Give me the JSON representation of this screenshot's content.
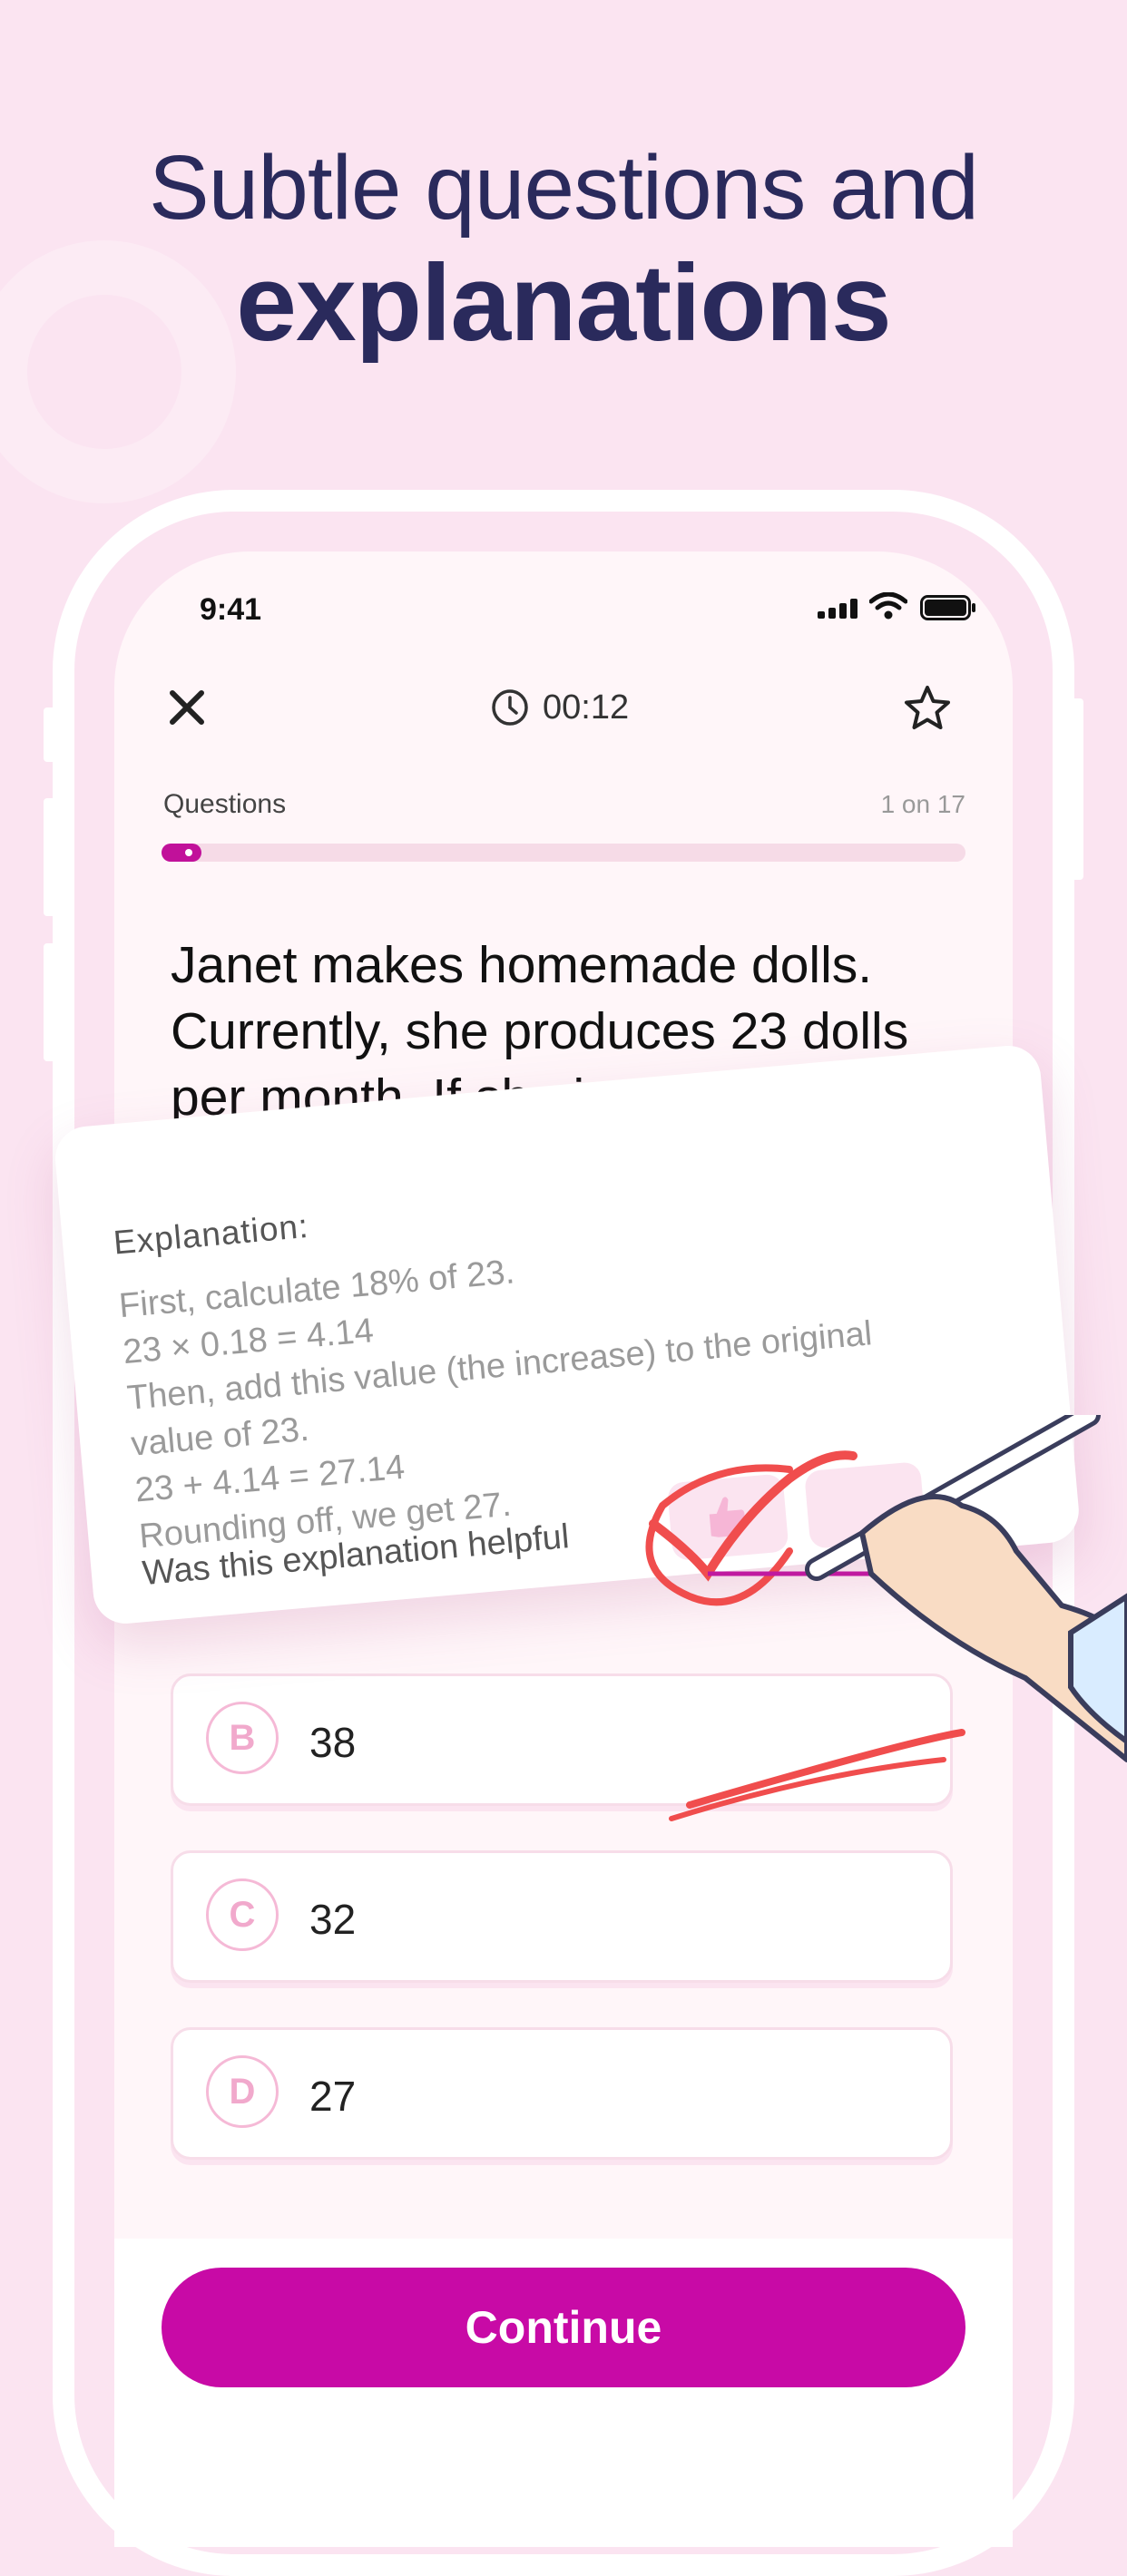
{
  "headline": {
    "line1": "Subtle questions and",
    "line2": "explanations"
  },
  "status": {
    "time": "9:41"
  },
  "header": {
    "timer": "00:12"
  },
  "progress": {
    "label": "Questions",
    "count": "1 on 17",
    "fraction": 0.06
  },
  "question": {
    "text": "Janet makes homemade dolls. Currently, she produces 23 dolls per month. If she increased h"
  },
  "answers": [
    {
      "letter": "B",
      "text": "38"
    },
    {
      "letter": "C",
      "text": "32"
    },
    {
      "letter": "D",
      "text": "27"
    }
  ],
  "explanation": {
    "title": "Explanation:",
    "lines": [
      "First, calculate 18% of 23.",
      "23 × 0.18 = 4.14",
      "Then, add this value (the increase) to the original",
      "value of 23.",
      "23 + 4.14 = 27.14",
      "Rounding off, we get 27."
    ],
    "helpful_prompt": "Was this explanation helpful"
  },
  "footer": {
    "continue_label": "Continue"
  },
  "colors": {
    "accent": "#c80aa6",
    "background": "#fbe4f1",
    "headline": "#2a2a5c"
  }
}
